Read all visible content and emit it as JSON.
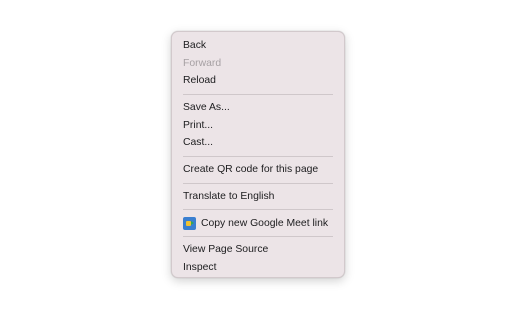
{
  "context_menu": {
    "items": {
      "back": "Back",
      "forward": "Forward",
      "reload": "Reload",
      "save_as": "Save As...",
      "print": "Print...",
      "cast": "Cast...",
      "create_qr": "Create QR code for this page",
      "translate": "Translate to English",
      "copy_meet": "Copy new Google Meet link",
      "view_source": "View Page Source",
      "inspect": "Inspect"
    },
    "disabled": [
      "forward"
    ],
    "meet_icon": "google-meet-icon"
  },
  "colors": {
    "menu_background": "#ece4e7",
    "text": "#1c1c1e",
    "disabled_text": "#a6a0a3",
    "separator": "#cfc7ca"
  }
}
